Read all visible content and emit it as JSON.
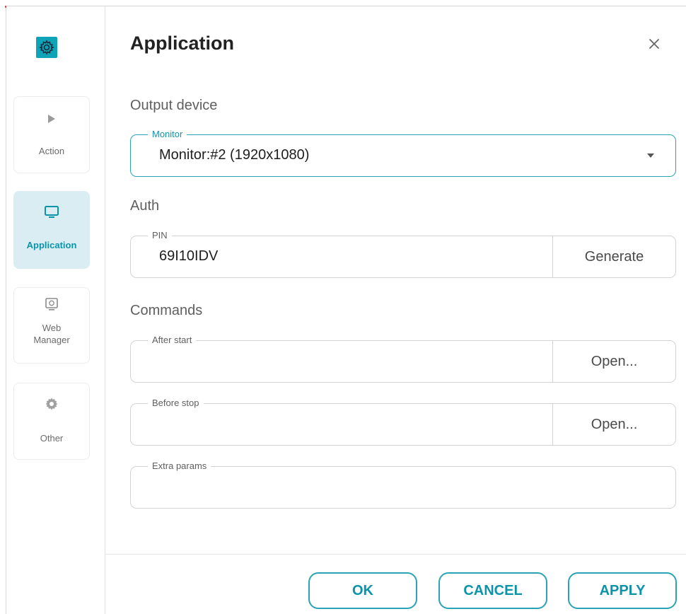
{
  "sidebar": {
    "logo_icon": "gear-icon",
    "items": [
      {
        "label": "Action",
        "icon": "play-icon",
        "active": false
      },
      {
        "label": "Application",
        "icon": "monitor-icon",
        "active": true
      },
      {
        "label": "Web\nManager",
        "icon": "web-manager-icon",
        "active": false
      },
      {
        "label": "Other",
        "icon": "gear-icon",
        "active": false
      }
    ]
  },
  "dialog": {
    "title": "Application",
    "close_icon": "close-icon"
  },
  "output_device": {
    "section_title": "Output device",
    "monitor_label": "Monitor",
    "monitor_value": "Monitor:#2 (1920x1080)"
  },
  "auth": {
    "section_title": "Auth",
    "pin_label": "PIN",
    "pin_value": "69I10IDV",
    "generate_label": "Generate"
  },
  "commands": {
    "section_title": "Commands",
    "after_start_label": "After start",
    "after_start_value": "",
    "after_start_button": "Open...",
    "before_stop_label": "Before stop",
    "before_stop_value": "",
    "before_stop_button": "Open...",
    "extra_params_label": "Extra params",
    "extra_params_value": ""
  },
  "footer": {
    "ok_label": "OK",
    "cancel_label": "CANCEL",
    "apply_label": "APPLY"
  },
  "colors": {
    "accent": "#0fa3b8",
    "active_nav_bg": "#d9edf3",
    "border": "#d3d3d3"
  }
}
